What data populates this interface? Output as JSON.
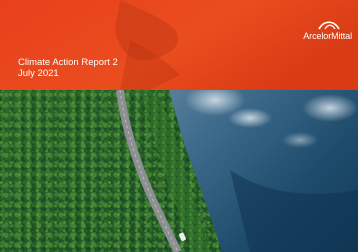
{
  "brand": {
    "name": "ArcelorMittal",
    "header_color": "#e8401c"
  },
  "report": {
    "title": "Climate Action Report 2",
    "date": "July 2021"
  },
  "cover_image": {
    "subject": "aerial-forest-road-lake"
  }
}
